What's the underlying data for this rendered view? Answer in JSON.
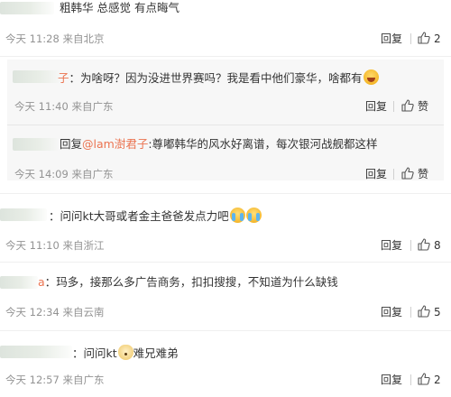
{
  "actions": {
    "reply_label": "回复",
    "like_label": "赞"
  },
  "comments": [
    {
      "text": "粗韩华 总感觉 有点晦气",
      "meta": "今天 11:28 来自北京",
      "likes": "2"
    },
    {
      "text": "问问kt大哥或者金主爸爸发点力吧",
      "meta": "今天 11:10 来自浙江",
      "likes": "8"
    },
    {
      "text": "玛多，接那么多广告商务，扣扣搜搜，不知道为什么缺钱",
      "meta": "今天 12:34 来自云南",
      "likes": "5"
    },
    {
      "text": "问问kt",
      "text_suffix": "难兄难弟",
      "meta": "今天 12:57 来自广东",
      "likes": "2"
    }
  ],
  "replies": [
    {
      "user_suffix": "子",
      "colon": "：",
      "text": "为啥呀？因为没进世界赛吗？我是看中他们豪华，啥都有",
      "meta": "今天 11:40 来自广东"
    },
    {
      "prefix": "回复",
      "mention": "@lam澍君子",
      "colon": ":",
      "text": "尊嘟韩华的风水好离谱，每次银河战舰都这样",
      "meta": "今天 14:09 来自广东"
    }
  ],
  "partial_names": {
    "c3": "a",
    "c3_colon": "：",
    "c2_colon": "：",
    "c4_colon": "："
  },
  "icons": {
    "thumb": "thumbs-up-icon",
    "laugh": "laughing-emoji-icon",
    "cry": "crying-emoji-icon",
    "dog": "dog-emoji-icon"
  }
}
